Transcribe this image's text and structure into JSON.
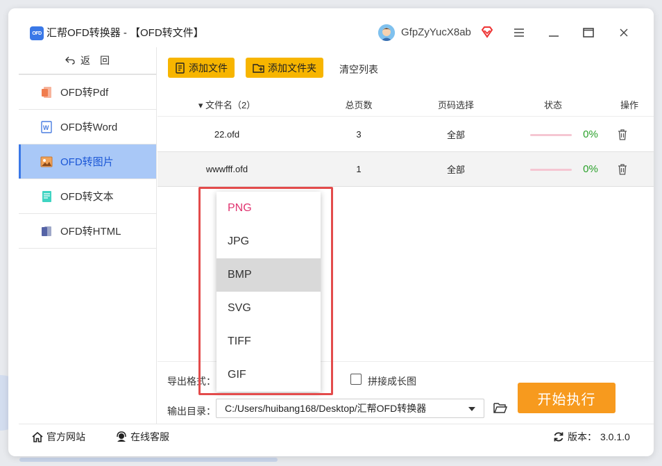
{
  "window": {
    "app_logo_text": "OFD",
    "title": "汇帮OFD转换器 - 【OFD转文件】",
    "user_name": "GfpZyYucX8ab"
  },
  "sidebar": {
    "back_label": "返　回",
    "items": [
      {
        "label": "OFD转Pdf",
        "icon": "pdf-icon"
      },
      {
        "label": "OFD转Word",
        "icon": "word-icon"
      },
      {
        "label": "OFD转图片",
        "icon": "image-icon",
        "active": true
      },
      {
        "label": "OFD转文本",
        "icon": "text-icon"
      },
      {
        "label": "OFD转HTML",
        "icon": "html-icon"
      }
    ]
  },
  "toolbar": {
    "add_file_label": "添加文件",
    "add_folder_label": "添加文件夹",
    "clear_list_label": "清空列表"
  },
  "table": {
    "headers": {
      "name": "▾ 文件名（2）",
      "pages": "总页数",
      "range": "页码选择",
      "status": "状态",
      "op": "操作"
    },
    "rows": [
      {
        "name": "22.ofd",
        "pages": "3",
        "range": "全部",
        "progress": "0%"
      },
      {
        "name": "wwwfff.ofd",
        "pages": "1",
        "range": "全部",
        "progress": "0%"
      }
    ]
  },
  "settings": {
    "export_format_label": "导出格式：",
    "stitch_label": "拼接成长图",
    "stitch_checked": false,
    "output_dir_label": "输出目录：",
    "output_dir_value": "C:/Users/huibang168/Desktop/汇帮OFD转换器",
    "run_label": "开始执行"
  },
  "dropdown": {
    "options": [
      "PNG",
      "JPG",
      "BMP",
      "SVG",
      "TIFF",
      "GIF"
    ],
    "selected": "PNG",
    "hovered": "BMP"
  },
  "footer": {
    "website_label": "官方网站",
    "support_label": "在线客服",
    "version_label": "版本：",
    "version_value": "3.0.1.0"
  },
  "colors": {
    "accent": "#3a78e7",
    "button_yellow": "#f7b500",
    "run_orange": "#f79a1e",
    "progress_green": "#2aa12a",
    "selected_pink": "#e0336f",
    "highlight_red": "#e34b4b"
  }
}
